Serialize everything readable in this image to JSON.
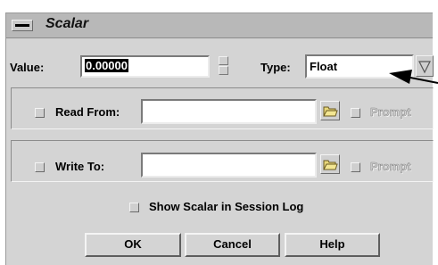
{
  "window": {
    "title": "Scalar"
  },
  "value_row": {
    "label": "Value:",
    "value": "0.00000",
    "type_label": "Type:",
    "type_value": "Float"
  },
  "read_from": {
    "label": "Read From:",
    "value": "",
    "prompt": "Prompt"
  },
  "write_to": {
    "label": "Write To:",
    "value": "",
    "prompt": "Prompt"
  },
  "session_log": {
    "label": "Show Scalar in Session Log"
  },
  "buttons": {
    "ok": "OK",
    "cancel": "Cancel",
    "help": "Help"
  }
}
